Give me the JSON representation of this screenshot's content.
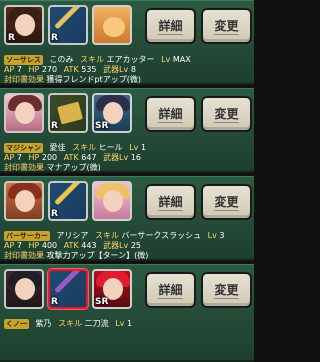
{
  "cards": [
    {
      "badge": "ソーサレス",
      "name": "このみ",
      "skill_label": "スキル",
      "skill": "エアカッター",
      "level_label": "Lv",
      "level": "MAX",
      "ap_label": "AP",
      "ap": "7",
      "hp_label": "HP",
      "hp": "270",
      "atk_label": "ATK",
      "atk": "535",
      "weapon_label": "武器Lv",
      "weapon_lv": "8",
      "seal_label": "封印書効果",
      "seal": "獲得フレンドptアップ(微)",
      "detail": "詳細",
      "change": "変更",
      "icons": [
        {
          "type": "char",
          "rarity": "R"
        },
        {
          "type": "weapon",
          "rarity": "R"
        },
        {
          "type": "pet",
          "rarity": ""
        }
      ]
    },
    {
      "badge": "マジシャン",
      "name": "愛佳",
      "skill_label": "スキル",
      "skill": "ヒール",
      "level_label": "Lv",
      "level": "1",
      "ap_label": "AP",
      "ap": "7",
      "hp_label": "HP",
      "hp": "200",
      "atk_label": "ATK",
      "atk": "647",
      "weapon_label": "武器Lv",
      "weapon_lv": "16",
      "seal_label": "封印書効果",
      "seal": "マナアップ(微)",
      "detail": "詳細",
      "change": "変更",
      "icons": [
        {
          "type": "char",
          "rarity": ""
        },
        {
          "type": "book",
          "rarity": "R"
        },
        {
          "type": "char2",
          "rarity": "SR"
        }
      ]
    },
    {
      "badge": "バーサーカー",
      "name": "アリシア",
      "skill_label": "スキル",
      "skill": "バーサークスラッシュ",
      "level_label": "Lv",
      "level": "3",
      "ap_label": "AP",
      "ap": "7",
      "hp_label": "HP",
      "hp": "400",
      "atk_label": "ATK",
      "atk": "443",
      "weapon_label": "武器Lv",
      "weapon_lv": "25",
      "seal_label": "封印書効果",
      "seal": "攻撃力アップ【ターン】(微)",
      "detail": "詳細",
      "change": "変更",
      "icons": [
        {
          "type": "char",
          "rarity": ""
        },
        {
          "type": "weapon",
          "rarity": "R"
        },
        {
          "type": "char2",
          "rarity": ""
        }
      ]
    },
    {
      "badge": "くノ一",
      "name": "紫乃",
      "skill_label": "スキル",
      "skill": "二刀流",
      "level_label": "Lv",
      "level": "1",
      "detail": "詳細",
      "change": "変更",
      "icons": [
        {
          "type": "char",
          "rarity": ""
        },
        {
          "type": "weapon",
          "rarity": "R"
        },
        {
          "type": "char2",
          "rarity": "SR"
        }
      ]
    }
  ],
  "colors": {
    "card_bg_top": "#2b5a42",
    "card_bg_bottom": "#1e3f2f",
    "key": "#ffd76a",
    "value": "#ffffff",
    "button_bg": "#e6e2d4",
    "selected_border": "#e31b2f"
  }
}
